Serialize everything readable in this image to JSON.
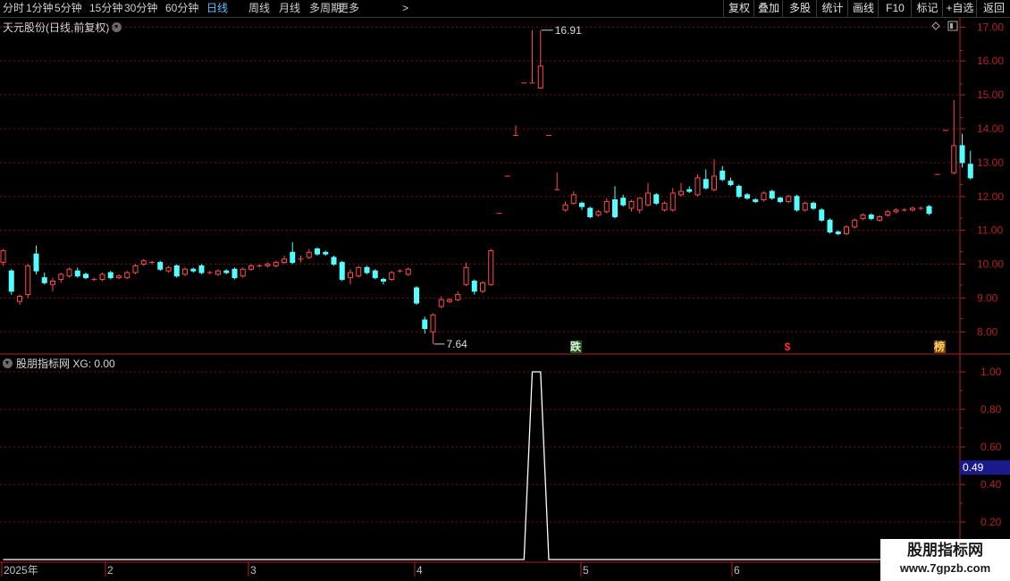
{
  "toolbar": {
    "periods": [
      "分时",
      "1分钟",
      "5分钟",
      "15分钟",
      "30分钟",
      "60分钟",
      "日线",
      "周线",
      "月线",
      "多周期",
      "更多"
    ],
    "active_period": "日线",
    "more_arrow": ">",
    "tools": [
      "复权",
      "叠加",
      "多股",
      "统计",
      "画线",
      "F10",
      "标记",
      "+自选",
      "返回"
    ]
  },
  "chart": {
    "title": "天元股份(日线,前复权)",
    "high_label": "16.91",
    "low_label": "7.64",
    "markers": {
      "die": "跌",
      "dollar": "$",
      "bang": "榜"
    },
    "price_axis": [
      "17.00",
      "16.00",
      "15.00",
      "14.00",
      "13.00",
      "12.00",
      "11.00",
      "10.00",
      "9.00",
      "8.00"
    ]
  },
  "indicator": {
    "title": "股朋指标网",
    "expr": "XG: 0.00",
    "axis": [
      "1.00",
      "0.80",
      "0.60",
      "0.40",
      "0.20"
    ],
    "current_value": "0.49"
  },
  "time_axis": [
    "2025年",
    "2",
    "3",
    "4",
    "5",
    "6"
  ],
  "watermark": {
    "line1": "股朋指标网",
    "line2": "www.7gpzb.com"
  },
  "colors": {
    "up": "#ff4a4a",
    "down": "#54ffff",
    "axis": "#b42020",
    "grid": "#7a0f0f",
    "active": "#59c0ff"
  },
  "chart_data": {
    "type": "candlestick",
    "ylim": [
      7.4,
      17.3
    ],
    "candles": [
      [
        10.05,
        10.4,
        10.45,
        9.95
      ],
      [
        9.8,
        9.2,
        9.85,
        9.1
      ],
      [
        8.9,
        9.05,
        9.1,
        8.8
      ],
      [
        9.1,
        9.95,
        10.0,
        9.0
      ],
      [
        10.3,
        9.8,
        10.55,
        9.7
      ],
      [
        9.6,
        9.45,
        9.75,
        9.4
      ],
      [
        9.4,
        9.5,
        9.6,
        9.2
      ],
      [
        9.55,
        9.7,
        9.75,
        9.45
      ],
      [
        9.65,
        9.85,
        9.9,
        9.6
      ],
      [
        9.8,
        9.65,
        9.9,
        9.6
      ],
      [
        9.7,
        9.6,
        9.75,
        9.55
      ],
      [
        9.55,
        9.55,
        9.6,
        9.5
      ],
      [
        9.55,
        9.7,
        9.75,
        9.5
      ],
      [
        9.75,
        9.6,
        9.8,
        9.55
      ],
      [
        9.6,
        9.65,
        9.7,
        9.55
      ],
      [
        9.6,
        9.75,
        9.8,
        9.55
      ],
      [
        9.75,
        9.95,
        10.0,
        9.7
      ],
      [
        10.0,
        10.1,
        10.15,
        9.95
      ],
      [
        10.05,
        10.05,
        10.1,
        10.0
      ],
      [
        10.05,
        9.85,
        10.1,
        9.8
      ],
      [
        9.8,
        9.9,
        9.95,
        9.75
      ],
      [
        9.95,
        9.65,
        10.0,
        9.6
      ],
      [
        9.7,
        9.85,
        9.9,
        9.65
      ],
      [
        9.85,
        9.8,
        9.9,
        9.75
      ],
      [
        9.95,
        9.75,
        10.0,
        9.7
      ],
      [
        9.75,
        9.75,
        9.8,
        9.7
      ],
      [
        9.7,
        9.8,
        9.85,
        9.65
      ],
      [
        9.8,
        9.75,
        9.85,
        9.7
      ],
      [
        9.85,
        9.6,
        9.9,
        9.55
      ],
      [
        9.65,
        9.85,
        9.9,
        9.6
      ],
      [
        9.85,
        9.95,
        10.0,
        9.8
      ],
      [
        9.95,
        9.95,
        10.0,
        9.9
      ],
      [
        9.95,
        10.0,
        10.05,
        9.9
      ],
      [
        9.95,
        10.05,
        10.1,
        9.9
      ],
      [
        10.05,
        10.15,
        10.25,
        10.0
      ],
      [
        10.35,
        10.05,
        10.65,
        10.0
      ],
      [
        10.15,
        10.15,
        10.25,
        10.05
      ],
      [
        10.2,
        10.35,
        10.45,
        10.15
      ],
      [
        10.45,
        10.3,
        10.5,
        10.25
      ],
      [
        10.35,
        10.3,
        10.4,
        10.25
      ],
      [
        10.2,
        10.0,
        10.25,
        9.95
      ],
      [
        10.05,
        9.55,
        10.1,
        9.5
      ],
      [
        9.6,
        9.75,
        9.85,
        9.4
      ],
      [
        9.65,
        9.9,
        9.95,
        9.6
      ],
      [
        9.9,
        9.75,
        9.95,
        9.7
      ],
      [
        9.8,
        9.6,
        9.85,
        9.55
      ],
      [
        9.55,
        9.5,
        9.6,
        9.4
      ],
      [
        9.55,
        9.75,
        9.8,
        9.5
      ],
      [
        9.8,
        9.8,
        9.85,
        9.75
      ],
      [
        9.7,
        9.85,
        9.9,
        9.65
      ],
      [
        9.3,
        8.85,
        9.35,
        8.8
      ],
      [
        8.35,
        8.1,
        8.45,
        7.95
      ],
      [
        8.0,
        8.5,
        8.55,
        7.64
      ],
      [
        8.75,
        8.95,
        9.05,
        8.7
      ],
      [
        8.9,
        8.95,
        9.0,
        8.85
      ],
      [
        8.95,
        9.1,
        9.2,
        8.9
      ],
      [
        9.4,
        9.9,
        10.05,
        9.35
      ],
      [
        9.5,
        9.2,
        9.55,
        9.1
      ],
      [
        9.2,
        9.45,
        9.5,
        9.15
      ],
      [
        9.4,
        10.4,
        10.45,
        9.35
      ],
      [
        11.5,
        11.5,
        11.5,
        11.5
      ],
      [
        12.6,
        12.6,
        12.6,
        12.6
      ],
      [
        13.8,
        13.8,
        14.1,
        13.8
      ],
      [
        15.35,
        15.35,
        15.35,
        15.35
      ],
      [
        15.35,
        15.35,
        16.91,
        15.35
      ],
      [
        15.2,
        15.85,
        16.91,
        15.2
      ],
      [
        13.8,
        13.8,
        13.8,
        13.8
      ],
      [
        12.2,
        12.2,
        12.7,
        12.2
      ],
      [
        11.6,
        11.75,
        11.85,
        11.55
      ],
      [
        11.8,
        12.05,
        12.15,
        11.75
      ],
      [
        11.8,
        11.7,
        11.85,
        11.6
      ],
      [
        11.65,
        11.4,
        11.7,
        11.35
      ],
      [
        11.45,
        11.55,
        11.6,
        11.4
      ],
      [
        11.55,
        11.85,
        11.95,
        11.5
      ],
      [
        11.9,
        11.4,
        12.3,
        11.35
      ],
      [
        11.95,
        11.75,
        12.05,
        11.7
      ],
      [
        11.65,
        11.85,
        11.9,
        11.55
      ],
      [
        11.6,
        11.95,
        11.95,
        11.5
      ],
      [
        11.75,
        12.1,
        12.4,
        11.7
      ],
      [
        12.05,
        11.8,
        12.1,
        11.75
      ],
      [
        11.6,
        11.8,
        11.85,
        11.55
      ],
      [
        11.6,
        12.1,
        12.25,
        11.55
      ],
      [
        12.05,
        12.15,
        12.4,
        12.0
      ],
      [
        12.2,
        12.15,
        12.3,
        12.1
      ],
      [
        12.05,
        12.55,
        12.65,
        12.0
      ],
      [
        12.5,
        12.25,
        12.8,
        12.2
      ],
      [
        12.2,
        12.6,
        13.1,
        12.15
      ],
      [
        12.75,
        12.5,
        12.9,
        12.45
      ],
      [
        12.45,
        12.35,
        12.55,
        12.3
      ],
      [
        12.3,
        12.0,
        12.35,
        11.95
      ],
      [
        12.05,
        11.95,
        12.1,
        11.9
      ],
      [
        11.9,
        11.85,
        11.95,
        11.8
      ],
      [
        11.9,
        12.1,
        12.15,
        11.85
      ],
      [
        12.15,
        11.95,
        12.2,
        11.9
      ],
      [
        11.95,
        11.85,
        12.0,
        11.8
      ],
      [
        11.85,
        12.0,
        12.05,
        11.8
      ],
      [
        12.0,
        11.6,
        12.05,
        11.55
      ],
      [
        11.6,
        11.8,
        11.85,
        11.55
      ],
      [
        11.8,
        11.65,
        11.85,
        11.6
      ],
      [
        11.6,
        11.3,
        11.65,
        11.25
      ],
      [
        11.3,
        10.95,
        11.35,
        10.9
      ],
      [
        10.95,
        10.9,
        11.0,
        10.85
      ],
      [
        10.9,
        11.1,
        11.15,
        10.85
      ],
      [
        11.1,
        11.3,
        11.35,
        11.05
      ],
      [
        11.35,
        11.45,
        11.5,
        11.3
      ],
      [
        11.45,
        11.35,
        11.5,
        11.3
      ],
      [
        11.3,
        11.4,
        11.45,
        11.25
      ],
      [
        11.45,
        11.55,
        11.6,
        11.4
      ],
      [
        11.55,
        11.6,
        11.65,
        11.5
      ],
      [
        11.6,
        11.6,
        11.65,
        11.55
      ],
      [
        11.6,
        11.65,
        11.7,
        11.55
      ],
      [
        11.65,
        11.65,
        11.7,
        11.6
      ],
      [
        11.7,
        11.5,
        11.75,
        11.45
      ],
      [
        12.65,
        12.65,
        12.65,
        12.65
      ],
      [
        13.95,
        13.95,
        13.95,
        13.95
      ],
      [
        12.7,
        13.5,
        14.85,
        12.65
      ],
      [
        13.5,
        13.0,
        13.85,
        12.85
      ],
      [
        12.95,
        12.55,
        13.35,
        12.5
      ]
    ],
    "signal": {
      "x_indices": [
        64,
        65
      ],
      "values": [
        1,
        1
      ]
    }
  }
}
